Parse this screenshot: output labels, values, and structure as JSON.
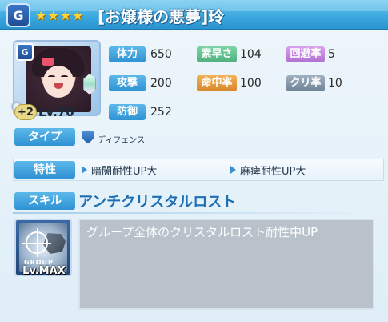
{
  "header": {
    "stars": [
      "★",
      "★",
      "★",
      "★"
    ],
    "title": "[お嬢様の悪夢]玲",
    "logo_letter": "G"
  },
  "portrait": {
    "badge_letter": "G",
    "plus": "+2",
    "level": "Lv.70"
  },
  "stats": {
    "hp": {
      "label": "体力",
      "value": "650"
    },
    "speed": {
      "label": "素早さ",
      "value": "104"
    },
    "evasion": {
      "label": "回避率",
      "value": "5"
    },
    "attack": {
      "label": "攻撃",
      "value": "200"
    },
    "accuracy": {
      "label": "命中率",
      "value": "100"
    },
    "crit": {
      "label": "クリ率",
      "value": "10"
    },
    "defense": {
      "label": "防御",
      "value": "252"
    }
  },
  "type": {
    "label": "タイプ",
    "value": "ディフェンス",
    "icon": "shield-icon"
  },
  "traits": {
    "label": "特性",
    "items": [
      "暗闇耐性UP大",
      "麻痺耐性UP大"
    ]
  },
  "skill": {
    "label": "スキル",
    "name": "アンチクリスタルロスト",
    "icon_text": "GROUP",
    "level": "Lv.MAX",
    "description": "グループ全体のクリスタルロスト耐性中UP"
  },
  "colors": {
    "header_blue": "#39a8e0",
    "label_blue": "#2f92d4",
    "label_green": "#4db07c",
    "label_purple": "#b170cf",
    "label_orange": "#d7862a",
    "label_gray": "#6f8396",
    "skill_title": "#1f6fb3"
  }
}
